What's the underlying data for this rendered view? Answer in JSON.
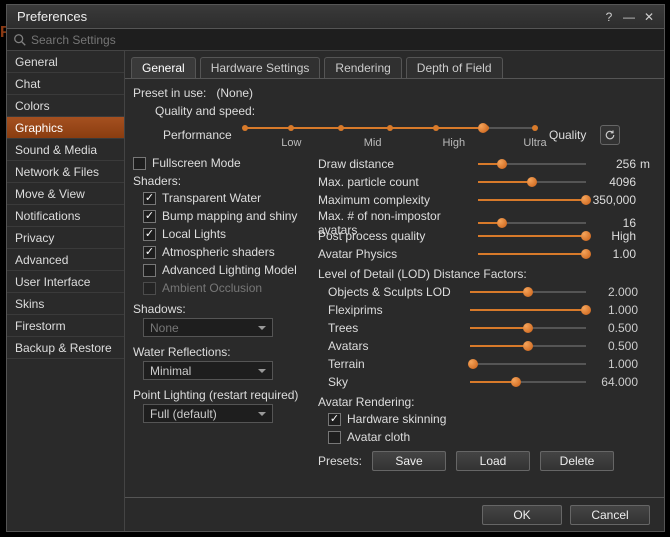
{
  "window": {
    "title": "Preferences"
  },
  "search": {
    "placeholder": "Search Settings"
  },
  "sidebar": {
    "items": [
      {
        "label": "General"
      },
      {
        "label": "Chat"
      },
      {
        "label": "Colors"
      },
      {
        "label": "Graphics",
        "active": true
      },
      {
        "label": "Sound & Media"
      },
      {
        "label": "Network & Files"
      },
      {
        "label": "Move & View"
      },
      {
        "label": "Notifications"
      },
      {
        "label": "Privacy"
      },
      {
        "label": "Advanced"
      },
      {
        "label": "User Interface"
      },
      {
        "label": "Skins"
      },
      {
        "label": "Firestorm"
      },
      {
        "label": "Backup & Restore"
      }
    ]
  },
  "tabs": [
    {
      "label": "General",
      "active": true
    },
    {
      "label": "Hardware Settings"
    },
    {
      "label": "Rendering"
    },
    {
      "label": "Depth of Field"
    }
  ],
  "preset": {
    "label": "Preset in use:",
    "value": "(None)"
  },
  "quality": {
    "title": "Quality and speed:",
    "left": "Performance",
    "right": "Quality",
    "ticks": [
      "Low",
      "Mid",
      "High",
      "Ultra"
    ],
    "value_pct": 82
  },
  "fullscreen": {
    "label": "Fullscreen Mode",
    "checked": false
  },
  "shaders": {
    "title": "Shaders:",
    "items": [
      {
        "label": "Transparent Water",
        "checked": true
      },
      {
        "label": "Bump mapping and shiny",
        "checked": true
      },
      {
        "label": "Local Lights",
        "checked": true
      },
      {
        "label": "Atmospheric shaders",
        "checked": true
      },
      {
        "label": "Advanced Lighting Model",
        "checked": false
      },
      {
        "label": "Ambient Occlusion",
        "checked": false,
        "disabled": true
      }
    ]
  },
  "shadows": {
    "title": "Shadows:",
    "value": "None",
    "disabled": true
  },
  "water": {
    "title": "Water Reflections:",
    "value": "Minimal"
  },
  "pointlight": {
    "title": "Point Lighting (restart required)",
    "value": "Full (default)"
  },
  "right_sliders": [
    {
      "label": "Draw distance",
      "pct": 22,
      "value": "256",
      "unit": "m"
    },
    {
      "label": "Max. particle count",
      "pct": 50,
      "value": "4096"
    },
    {
      "label": "Maximum complexity",
      "pct": 100,
      "value": "350,000"
    },
    {
      "label": "Max. # of non-impostor avatars",
      "pct": 22,
      "value": "16"
    },
    {
      "label": "Post process quality",
      "pct": 100,
      "value": "High"
    },
    {
      "label": "Avatar Physics",
      "pct": 100,
      "value": "1.00"
    }
  ],
  "lod": {
    "title": "Level of Detail (LOD) Distance Factors:",
    "items": [
      {
        "label": "Objects & Sculpts LOD",
        "pct": 50,
        "value": "2.000"
      },
      {
        "label": "Flexiprims",
        "pct": 100,
        "value": "1.000"
      },
      {
        "label": "Trees",
        "pct": 50,
        "value": "0.500"
      },
      {
        "label": "Avatars",
        "pct": 50,
        "value": "0.500"
      },
      {
        "label": "Terrain",
        "pct": 3,
        "value": "1.000"
      },
      {
        "label": "Sky",
        "pct": 40,
        "value": "64.000"
      }
    ]
  },
  "avatar_render": {
    "title": "Avatar Rendering:",
    "items": [
      {
        "label": "Hardware skinning",
        "checked": true
      },
      {
        "label": "Avatar cloth",
        "checked": false
      }
    ]
  },
  "presets": {
    "label": "Presets:",
    "save": "Save",
    "load": "Load",
    "delete": "Delete"
  },
  "footer": {
    "ok": "OK",
    "cancel": "Cancel"
  }
}
